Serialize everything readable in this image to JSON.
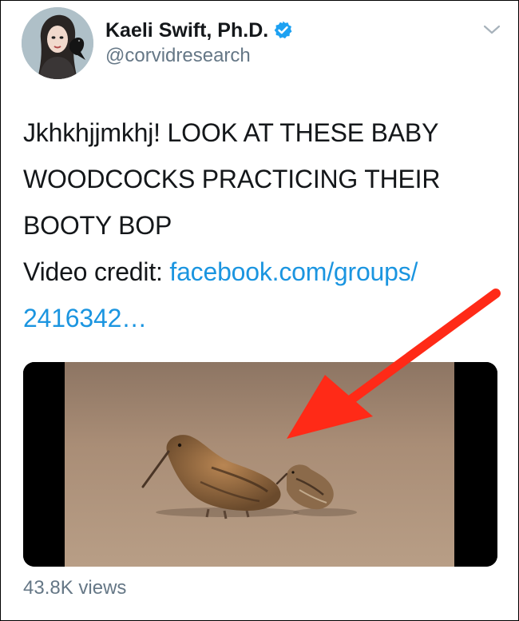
{
  "tweet": {
    "display_name": "Kaeli Swift, Ph.D.",
    "handle": "@corvidresearch",
    "text": "Jkhkhjjmkhj! LOOK AT THESE BABY WOODCOCKS PRACTICING THEIR BOOTY BOP",
    "credit_label": "Video credit: ",
    "credit_link": "facebook.com/groups/​2416342…",
    "views": "43.8K views"
  },
  "icons": {
    "verified": "verified-badge-icon",
    "menu": "chevron-down-icon",
    "annotation": "red-arrow-icon"
  },
  "colors": {
    "link": "#1b95e0",
    "secondary_text": "#657786",
    "verified": "#1da1f2",
    "arrow": "#ff2a17",
    "video_sand": "#a98d76",
    "letterbox": "#000000"
  }
}
